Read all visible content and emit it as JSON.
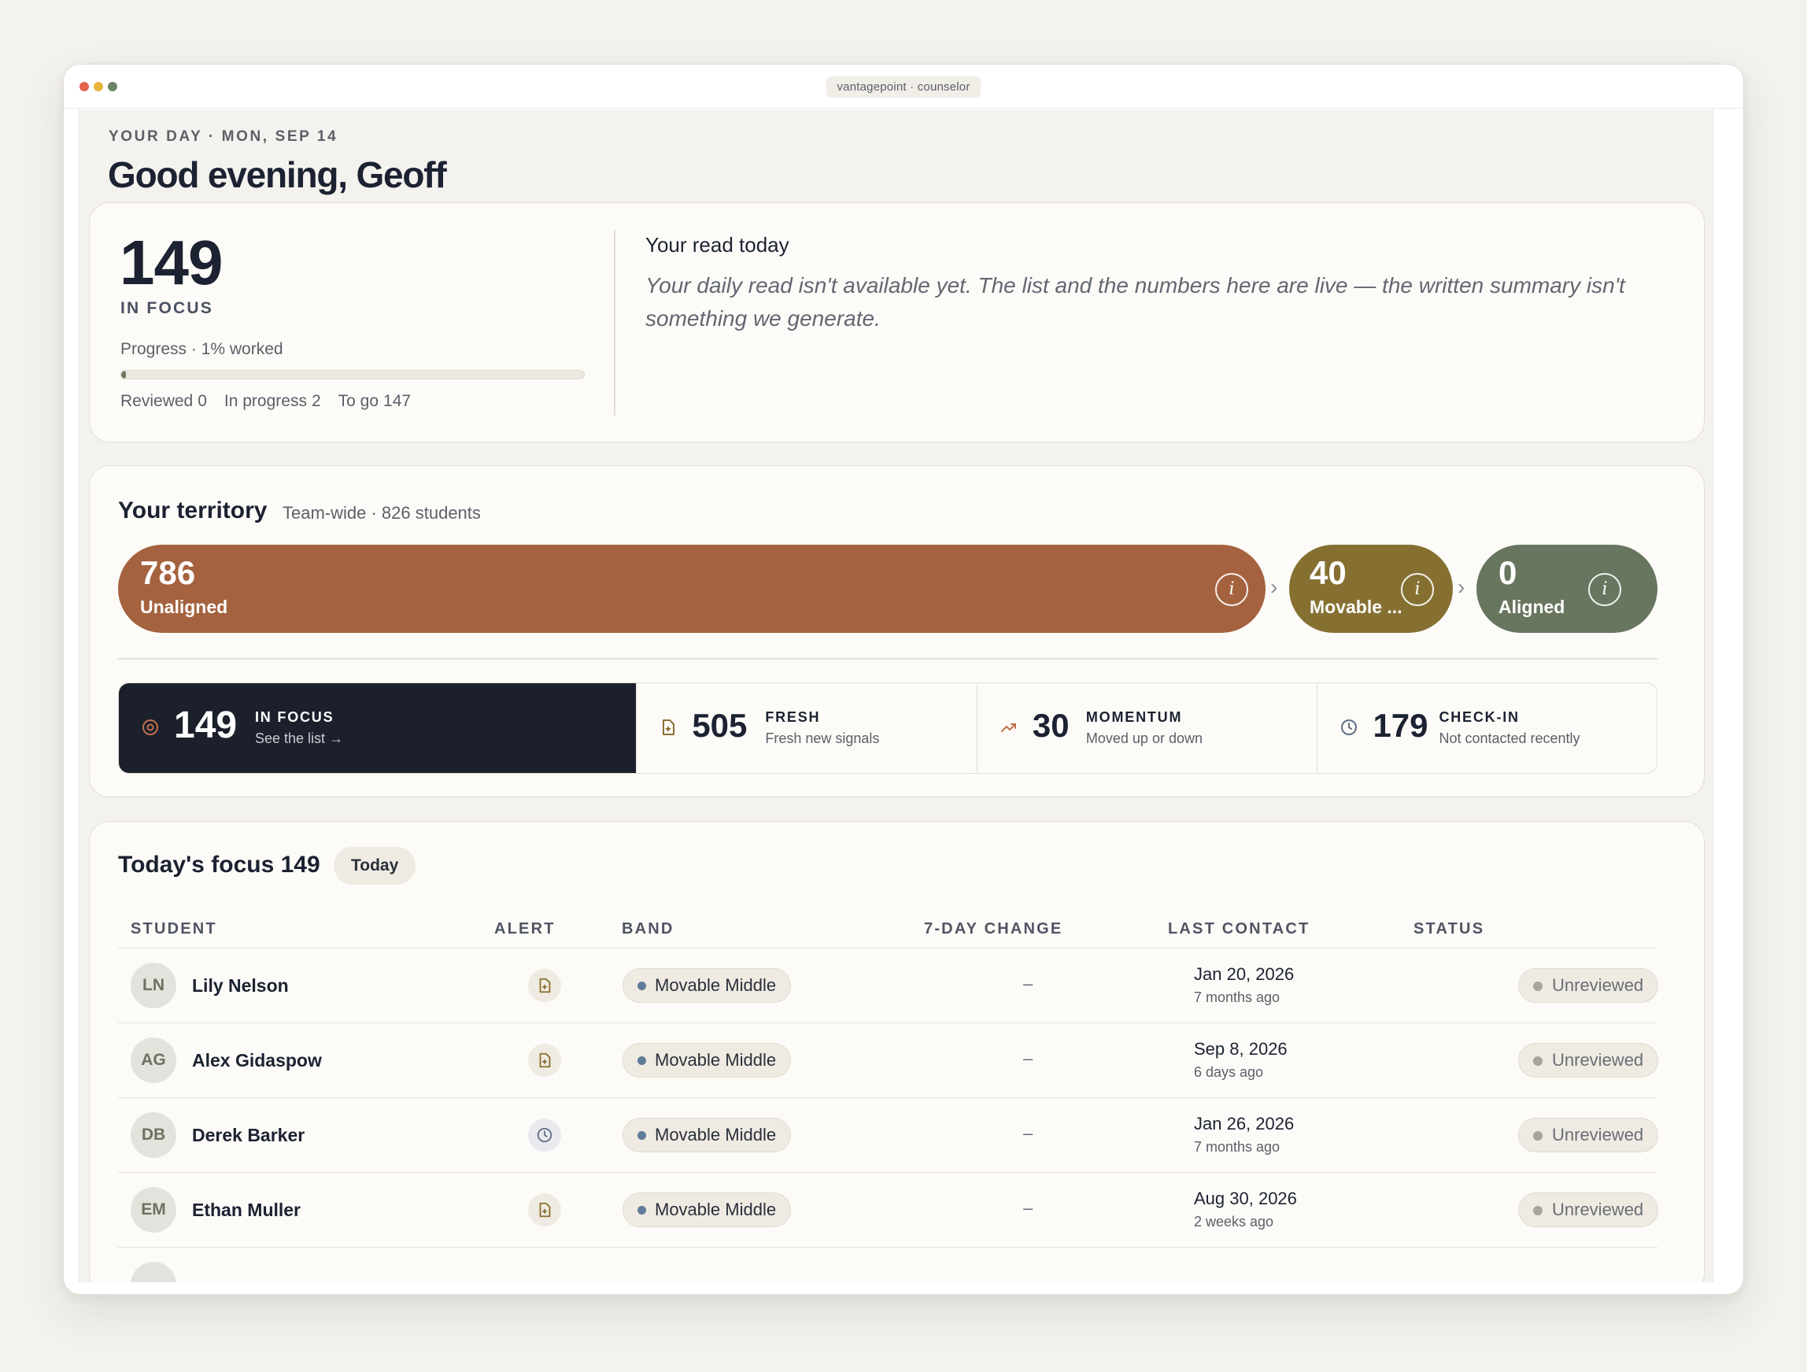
{
  "window": {
    "title": "vantagepoint · counselor"
  },
  "header": {
    "eyebrow": "YOUR DAY · MON, SEP 14",
    "greeting": "Good evening, Geoff"
  },
  "summary": {
    "in_focus_count": "149",
    "in_focus_label": "IN FOCUS",
    "progress_label": "Progress · 1% worked",
    "progress_fraction": 0.01,
    "reviewed_label": "Reviewed",
    "reviewed_value": "0",
    "in_progress_label": "In progress",
    "in_progress_value": "2",
    "to_go_label": "To go",
    "to_go_value": "147",
    "read_title": "Your read today",
    "read_body": "Your daily read isn't available yet. The list and the numbers here are live — the written summary isn't something we generate."
  },
  "territory": {
    "title": "Your territory",
    "subtitle": "Team-wide · 826 students",
    "segments": [
      {
        "value": "786",
        "label": "Unaligned",
        "color": "#a5623f",
        "info_icon": "info-icon"
      },
      {
        "value": "40",
        "label": "Movable ...",
        "color": "#857032",
        "info_icon": "info-icon"
      },
      {
        "value": "0",
        "label": "Aligned",
        "color": "#68755f",
        "info_icon": "info-icon"
      }
    ],
    "tiles": [
      {
        "icon": "target-icon",
        "value": "149",
        "title": "IN FOCUS",
        "sub": "See the list →"
      },
      {
        "icon": "document-icon",
        "value": "505",
        "title": "FRESH",
        "sub": "Fresh new signals"
      },
      {
        "icon": "trend-icon",
        "value": "30",
        "title": "MOMENTUM",
        "sub": "Moved up or down"
      },
      {
        "icon": "clock-icon",
        "value": "179",
        "title": "CHECK-IN",
        "sub": "Not contacted recently"
      }
    ]
  },
  "focus": {
    "title": "Today's focus 149",
    "filter_label": "Today",
    "columns": [
      "STUDENT",
      "ALERT",
      "BAND",
      "7-DAY CHANGE",
      "LAST CONTACT",
      "STATUS"
    ],
    "rows": [
      {
        "initials": "LN",
        "name": "Lily Nelson",
        "alert_icon": "document-icon",
        "band": "Movable Middle",
        "change": "–",
        "last_contact": "Jan 20, 2026",
        "ago": "7 months ago",
        "status": "Unreviewed"
      },
      {
        "initials": "AG",
        "name": "Alex Gidaspow",
        "alert_icon": "document-icon",
        "band": "Movable Middle",
        "change": "–",
        "last_contact": "Sep 8, 2026",
        "ago": "6 days ago",
        "status": "Unreviewed"
      },
      {
        "initials": "DB",
        "name": "Derek Barker",
        "alert_icon": "clock-icon",
        "band": "Movable Middle",
        "change": "–",
        "last_contact": "Jan 26, 2026",
        "ago": "7 months ago",
        "status": "Unreviewed"
      },
      {
        "initials": "EM",
        "name": "Ethan Muller",
        "alert_icon": "document-icon",
        "band": "Movable Middle",
        "change": "–",
        "last_contact": "Aug 30, 2026",
        "ago": "2 weeks ago",
        "status": "Unreviewed"
      }
    ]
  },
  "colors": {
    "dot_red": "#e2644f",
    "dot_yellow": "#e8b53c",
    "dot_green": "#6c8466",
    "accent_dark": "#1b202c"
  }
}
